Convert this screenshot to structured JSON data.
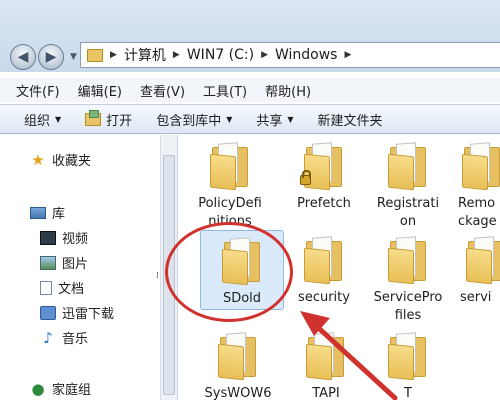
{
  "address": {
    "crumbs": [
      "计算机",
      "WIN7 (C:)",
      "Windows"
    ]
  },
  "menu": [
    "文件(F)",
    "编辑(E)",
    "查看(V)",
    "工具(T)",
    "帮助(H)"
  ],
  "toolbar": {
    "organize": "组织",
    "open": "打开",
    "include": "包含到库中",
    "share": "共享",
    "new_folder": "新建文件夹"
  },
  "nav": {
    "favorites": "收藏夹",
    "libraries": "库",
    "videos": "视频",
    "pictures": "图片",
    "documents": "文档",
    "downloads": "迅雷下载",
    "music": "音乐",
    "homegroup": "家庭组"
  },
  "files": [
    {
      "name": "PolicyDefi\nnitions"
    },
    {
      "name": "Prefetch"
    },
    {
      "name": "Registrati\non"
    },
    {
      "name": "Remo\nckage"
    },
    {
      "name": "SDold"
    },
    {
      "name": "security"
    },
    {
      "name": "ServicePro\nfiles"
    },
    {
      "name": "servi"
    },
    {
      "name": "SysWOW6"
    },
    {
      "name": "TAPI"
    },
    {
      "name": "T"
    }
  ],
  "colors": {
    "annotation_red": "#d0322e",
    "selection": "#dbeafb"
  }
}
